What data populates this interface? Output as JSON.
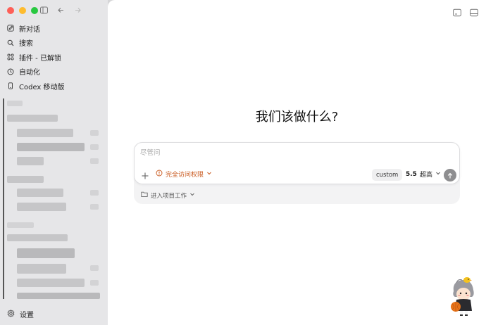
{
  "sidebar": {
    "nav": [
      {
        "label": "新对话",
        "icon": "edit-icon"
      },
      {
        "label": "搜索",
        "icon": "search-icon"
      },
      {
        "label": "插件 - 已解锁",
        "icon": "plugins-icon"
      },
      {
        "label": "自动化",
        "icon": "clock-icon"
      },
      {
        "label": "Codex 移动版",
        "icon": "phone-icon"
      }
    ],
    "settings_label": "设置"
  },
  "main": {
    "headline": "我们该做什么?",
    "composer": {
      "placeholder": "尽管问",
      "permission_label": "完全访问权限",
      "custom_label": "custom",
      "model_version": "5.5",
      "model_mode": "超高"
    },
    "project_label": "进入项目工作"
  },
  "colors": {
    "accent_orange": "#c8561a",
    "sidebar_bg": "#e6e6e8",
    "send_button": "#8e8e90"
  }
}
